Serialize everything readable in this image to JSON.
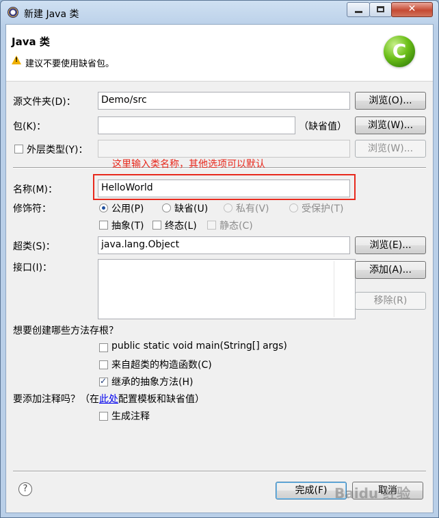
{
  "window": {
    "title": "新建 Java 类",
    "controls": {
      "minimize": "minimize",
      "maximize": "maximize",
      "close": "✕"
    }
  },
  "header": {
    "title": "Java 类",
    "warning": "建议不要使用缺省包。"
  },
  "form": {
    "source_folder": {
      "label": "源文件夹(D)：",
      "value": "Demo/src",
      "button": "浏览(O)..."
    },
    "package": {
      "label": "包(K)：",
      "value": "",
      "default_note": "（缺省值）",
      "button": "浏览(W)..."
    },
    "enclosing": {
      "label": "外层类型(Y)：",
      "value": "",
      "button": "浏览(W)...",
      "checked": false
    },
    "annotation": "这里输入类名称，其他选项可以默认",
    "name": {
      "label": "名称(M)：",
      "value": "HelloWorld"
    },
    "modifiers": {
      "label": "修饰符：",
      "radios": [
        {
          "label": "公用(P)",
          "selected": true,
          "enabled": true
        },
        {
          "label": "缺省(U)",
          "selected": false,
          "enabled": true
        },
        {
          "label": "私有(V)",
          "selected": false,
          "enabled": false
        },
        {
          "label": "受保护(T)",
          "selected": false,
          "enabled": false
        }
      ],
      "checks": [
        {
          "label": "抽象(T)",
          "checked": false,
          "enabled": true
        },
        {
          "label": "终态(L)",
          "checked": false,
          "enabled": true
        },
        {
          "label": "静态(C)",
          "checked": false,
          "enabled": false
        }
      ]
    },
    "superclass": {
      "label": "超类(S)：",
      "value": "java.lang.Object",
      "button": "浏览(E)..."
    },
    "interfaces": {
      "label": "接口(I)：",
      "add_button": "添加(A)...",
      "remove_button": "移除(R)"
    },
    "stubs": {
      "question": "想要创建哪些方法存根？",
      "options": [
        {
          "label": "public static void main(String[] args)",
          "checked": false
        },
        {
          "label": "来自超类的构造函数(C)",
          "checked": false
        },
        {
          "label": "继承的抽象方法(H)",
          "checked": true
        }
      ]
    },
    "comments": {
      "question_prefix": "要添加注释吗？（在",
      "link": "此处",
      "question_suffix": "配置模板和缺省值）",
      "option": "生成注释",
      "checked": false
    }
  },
  "footer": {
    "help": "?",
    "finish": "完成(F)",
    "cancel": "取消",
    "watermark": "Baidu 经验"
  },
  "colors": {
    "annotation": "#e8281c",
    "link": "#0000ee",
    "header_bg": "#ffffff",
    "dialog_bg": "#f0f0f0"
  }
}
